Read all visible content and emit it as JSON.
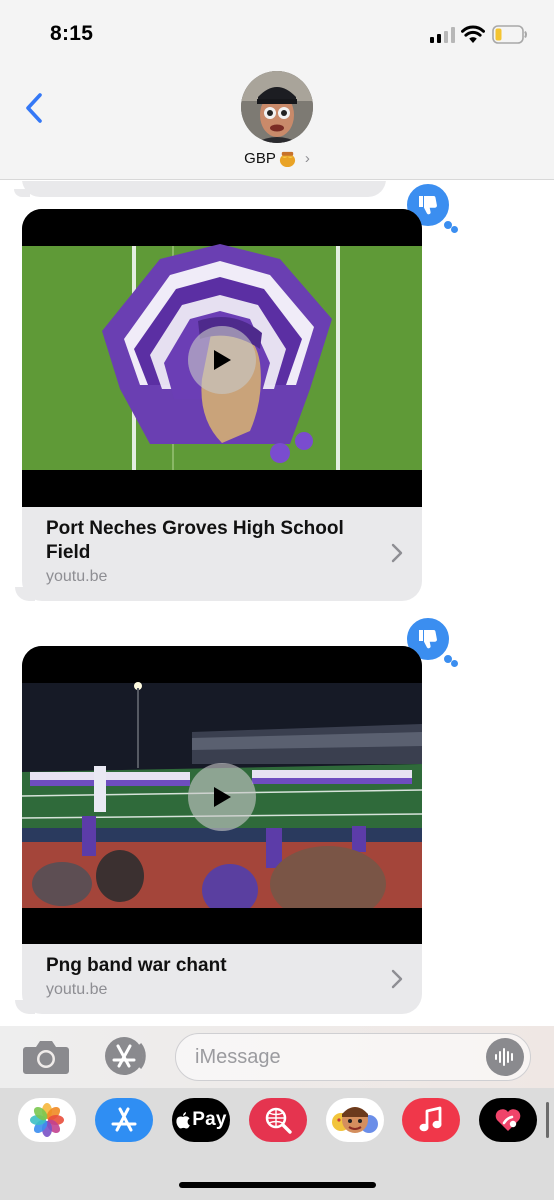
{
  "status_bar": {
    "time": "8:15",
    "signal_bars": 4,
    "signal_bars_active": 2,
    "battery_level": 0.2
  },
  "header": {
    "back_icon": "chevron-left-icon",
    "contact_name": "GBP",
    "contact_emoji_icon": "honey-pot-icon",
    "disclosure_icon": "chevron-right-icon"
  },
  "messages": [
    {
      "type": "link-preview",
      "tapback": "thumbs-down-icon",
      "title": "Port Neches Groves High School Field",
      "domain": "youtu.be",
      "thumbnail": "indian-head-logo-on-field"
    },
    {
      "type": "link-preview",
      "tapback": "thumbs-down-icon",
      "title": "Png band war chant",
      "domain": "youtu.be",
      "thumbnail": "marching-band-night-football-field"
    }
  ],
  "compose": {
    "placeholder": "iMessage",
    "camera_icon": "camera-icon",
    "apps_icon": "app-store-icon",
    "audio_icon": "audio-waveform-icon"
  },
  "app_drawer": {
    "apps": [
      {
        "name": "photos-icon"
      },
      {
        "name": "app-store-icon"
      },
      {
        "name": "apple-pay-icon",
        "label": "Pay"
      },
      {
        "name": "web-search-icon"
      },
      {
        "name": "memoji-icon"
      },
      {
        "name": "music-icon"
      },
      {
        "name": "digital-touch-icon"
      }
    ]
  },
  "colors": {
    "accent_blue": "#3b8ef0",
    "incoming_bubble": "#e9e9eb",
    "back_chevron": "#3478f6"
  }
}
